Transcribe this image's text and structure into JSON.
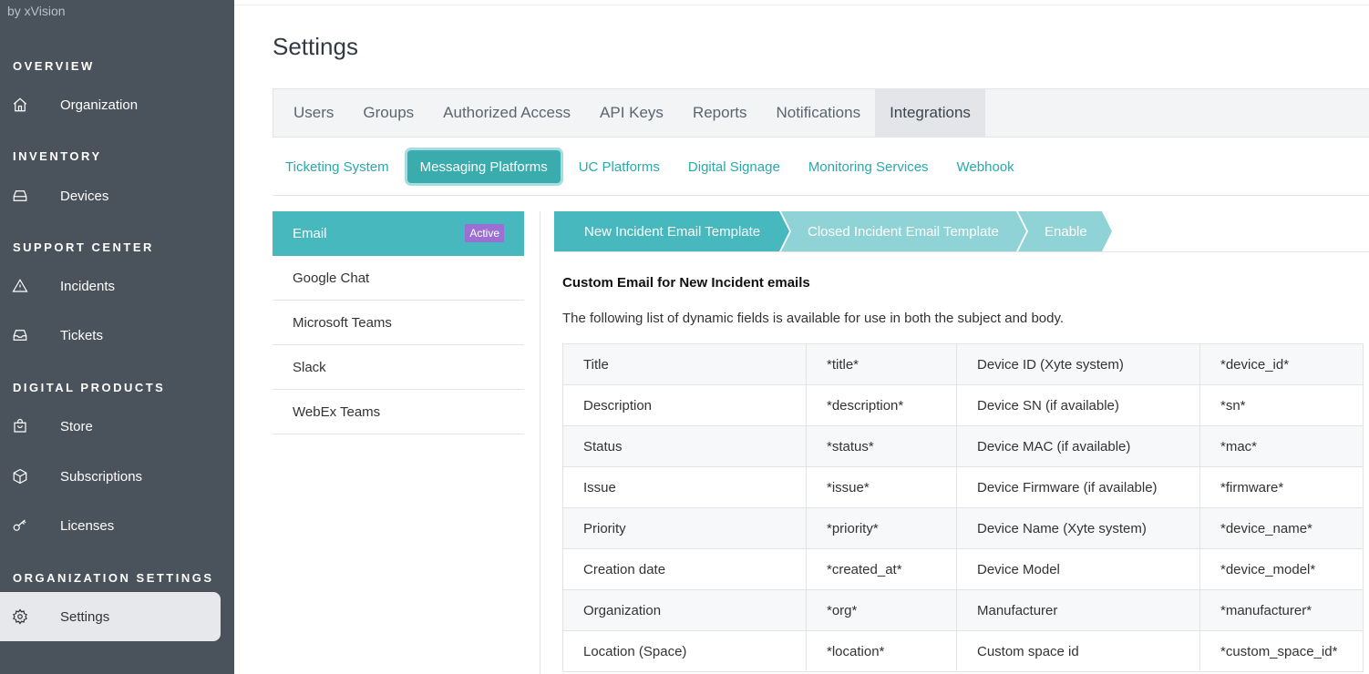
{
  "brand": "by xVision",
  "sidebar": {
    "sections": [
      "OVERVIEW",
      "INVENTORY",
      "SUPPORT CENTER",
      "DIGITAL PRODUCTS",
      "ORGANIZATION SETTINGS"
    ],
    "items": [
      {
        "label": "Organization",
        "icon": "home-icon"
      },
      {
        "label": "Devices",
        "icon": "device-icon"
      },
      {
        "label": "Incidents",
        "icon": "warning-icon"
      },
      {
        "label": "Tickets",
        "icon": "inbox-icon"
      },
      {
        "label": "Store",
        "icon": "bag-icon"
      },
      {
        "label": "Subscriptions",
        "icon": "box-icon"
      },
      {
        "label": "Licenses",
        "icon": "key-icon"
      },
      {
        "label": "Settings",
        "icon": "gear-icon"
      }
    ]
  },
  "page": {
    "title": "Settings"
  },
  "tabs": [
    "Users",
    "Groups",
    "Authorized Access",
    "API Keys",
    "Reports",
    "Notifications",
    "Integrations"
  ],
  "active_tab": "Integrations",
  "subtabs": [
    "Ticketing System",
    "Messaging Platforms",
    "UC Platforms",
    "Digital Signage",
    "Monitoring Services",
    "Webhook"
  ],
  "active_subtab": "Messaging Platforms",
  "platforms": [
    "Email",
    "Google Chat",
    "Microsoft Teams",
    "Slack",
    "WebEx Teams"
  ],
  "active_badge": "Active",
  "steps": [
    "New Incident Email Template",
    "Closed Incident Email Template",
    "Enable"
  ],
  "content": {
    "title": "Custom Email for New Incident emails",
    "description": "The following list of dynamic fields is available for use in both the subject and body."
  },
  "fields": [
    [
      "Title",
      "*title*",
      "Device ID (Xyte system)",
      "*device_id*"
    ],
    [
      "Description",
      "*description*",
      "Device SN (if available)",
      "*sn*"
    ],
    [
      "Status",
      "*status*",
      "Device MAC (if available)",
      "*mac*"
    ],
    [
      "Issue",
      "*issue*",
      "Device Firmware (if available)",
      "*firmware*"
    ],
    [
      "Priority",
      "*priority*",
      "Device Name (Xyte system)",
      "*device_name*"
    ],
    [
      "Creation date",
      "*created_at*",
      "Device Model",
      "*device_model*"
    ],
    [
      "Organization",
      "*org*",
      "Manufacturer",
      "*manufacturer*"
    ],
    [
      "Location (Space)",
      "*location*",
      "Custom space id",
      "*custom_space_id*"
    ]
  ],
  "colors": {
    "sidebar": "#4a525c",
    "accent": "#47b8bd",
    "step_active": "#47b8bd",
    "step_inactive": "#8fd3d6",
    "badge": "#9b6fd4"
  }
}
